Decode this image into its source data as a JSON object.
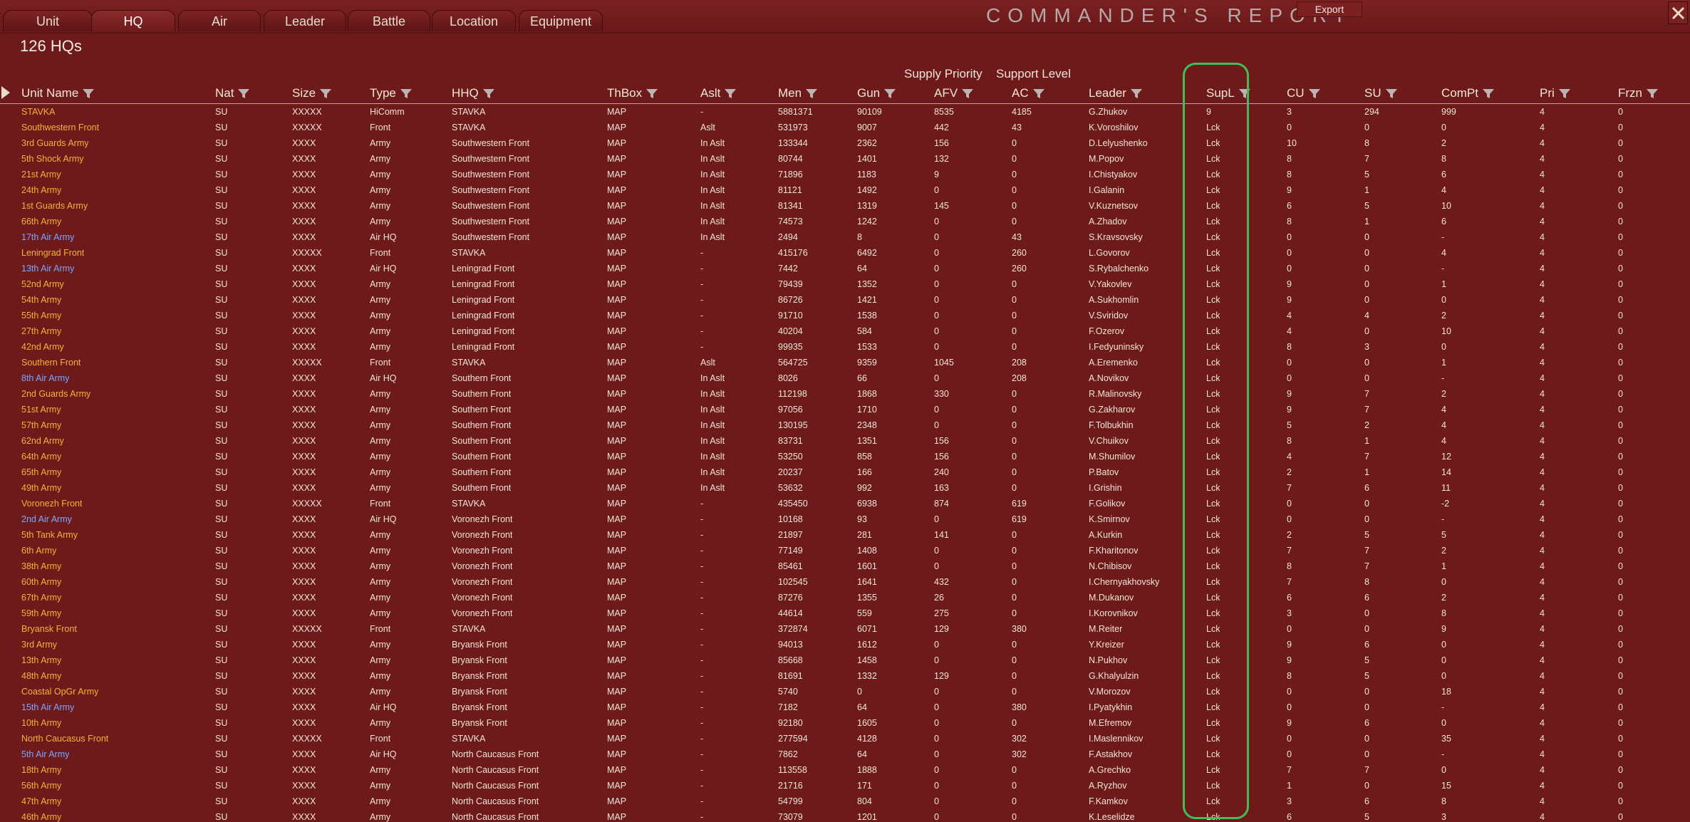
{
  "tabs": [
    "Unit",
    "HQ",
    "Air",
    "Leader",
    "Battle",
    "Location",
    "Equipment"
  ],
  "active_tab": "HQ",
  "report_title": "COMMANDER'S  REPORT",
  "export_label": "Export",
  "count_label": "126 HQs",
  "column_groups": [
    "Supply Priority",
    "Support Level"
  ],
  "columns": [
    "Unit Name",
    "Nat",
    "Size",
    "Type",
    "HHQ",
    "ThBox",
    "Aslt",
    "Men",
    "Gun",
    "AFV",
    "AC",
    "Leader",
    "SupL",
    "CU",
    "SU",
    "ComPt",
    "Pri",
    "Frzn"
  ],
  "colors": {
    "name_hq": "#f2b436",
    "name_air": "#7aa8ff",
    "highlight": "#3fbf57",
    "background": "#6e1a1b"
  },
  "rows": [
    {
      "name": "STAVKA",
      "air": false,
      "nat": "SU",
      "size": "XXXXX",
      "type": "HiComm",
      "hhq": "STAVKA",
      "thbox": "MAP",
      "aslt": "-",
      "men": "5881371",
      "gun": "90109",
      "afv": "8535",
      "ac": "4185",
      "leader": "G.Zhukov",
      "supl": "9",
      "cu": "3",
      "su": "294",
      "compt": "999",
      "pri": "4",
      "frzn": "0"
    },
    {
      "name": "Southwestern Front",
      "air": false,
      "nat": "SU",
      "size": "XXXXX",
      "type": "Front",
      "hhq": "STAVKA",
      "thbox": "MAP",
      "aslt": "Aslt",
      "men": "531973",
      "gun": "9007",
      "afv": "442",
      "ac": "43",
      "leader": "K.Voroshilov",
      "supl": "Lck",
      "cu": "0",
      "su": "0",
      "compt": "0",
      "pri": "4",
      "frzn": "0"
    },
    {
      "name": "3rd Guards Army",
      "air": false,
      "nat": "SU",
      "size": "XXXX",
      "type": "Army",
      "hhq": "Southwestern Front",
      "thbox": "MAP",
      "aslt": "In Aslt",
      "men": "133344",
      "gun": "2362",
      "afv": "156",
      "ac": "0",
      "leader": "D.Lelyushenko",
      "supl": "Lck",
      "cu": "10",
      "su": "8",
      "compt": "2",
      "pri": "4",
      "frzn": "0"
    },
    {
      "name": "5th Shock Army",
      "air": false,
      "nat": "SU",
      "size": "XXXX",
      "type": "Army",
      "hhq": "Southwestern Front",
      "thbox": "MAP",
      "aslt": "In Aslt",
      "men": "80744",
      "gun": "1401",
      "afv": "132",
      "ac": "0",
      "leader": "M.Popov",
      "supl": "Lck",
      "cu": "8",
      "su": "7",
      "compt": "8",
      "pri": "4",
      "frzn": "0"
    },
    {
      "name": "21st Army",
      "air": false,
      "nat": "SU",
      "size": "XXXX",
      "type": "Army",
      "hhq": "Southwestern Front",
      "thbox": "MAP",
      "aslt": "In Aslt",
      "men": "71896",
      "gun": "1183",
      "afv": "9",
      "ac": "0",
      "leader": "I.Chistyakov",
      "supl": "Lck",
      "cu": "8",
      "su": "5",
      "compt": "6",
      "pri": "4",
      "frzn": "0"
    },
    {
      "name": "24th Army",
      "air": false,
      "nat": "SU",
      "size": "XXXX",
      "type": "Army",
      "hhq": "Southwestern Front",
      "thbox": "MAP",
      "aslt": "In Aslt",
      "men": "81121",
      "gun": "1492",
      "afv": "0",
      "ac": "0",
      "leader": "I.Galanin",
      "supl": "Lck",
      "cu": "9",
      "su": "1",
      "compt": "4",
      "pri": "4",
      "frzn": "0"
    },
    {
      "name": "1st Guards Army",
      "air": false,
      "nat": "SU",
      "size": "XXXX",
      "type": "Army",
      "hhq": "Southwestern Front",
      "thbox": "MAP",
      "aslt": "In Aslt",
      "men": "81341",
      "gun": "1319",
      "afv": "145",
      "ac": "0",
      "leader": "V.Kuznetsov",
      "supl": "Lck",
      "cu": "6",
      "su": "5",
      "compt": "10",
      "pri": "4",
      "frzn": "0"
    },
    {
      "name": "66th Army",
      "air": false,
      "nat": "SU",
      "size": "XXXX",
      "type": "Army",
      "hhq": "Southwestern Front",
      "thbox": "MAP",
      "aslt": "In Aslt",
      "men": "74573",
      "gun": "1242",
      "afv": "0",
      "ac": "0",
      "leader": "A.Zhadov",
      "supl": "Lck",
      "cu": "8",
      "su": "1",
      "compt": "6",
      "pri": "4",
      "frzn": "0"
    },
    {
      "name": "17th Air Army",
      "air": true,
      "nat": "SU",
      "size": "XXXX",
      "type": "Air HQ",
      "hhq": "Southwestern Front",
      "thbox": "MAP",
      "aslt": "In Aslt",
      "men": "2494",
      "gun": "8",
      "afv": "0",
      "ac": "43",
      "leader": "S.Kravsovsky",
      "supl": "Lck",
      "cu": "0",
      "su": "0",
      "compt": "-",
      "pri": "4",
      "frzn": "0"
    },
    {
      "name": "Leningrad Front",
      "air": false,
      "nat": "SU",
      "size": "XXXXX",
      "type": "Front",
      "hhq": "STAVKA",
      "thbox": "MAP",
      "aslt": "-",
      "men": "415176",
      "gun": "6492",
      "afv": "0",
      "ac": "260",
      "leader": "L.Govorov",
      "supl": "Lck",
      "cu": "0",
      "su": "0",
      "compt": "4",
      "pri": "4",
      "frzn": "0"
    },
    {
      "name": "13th Air Army",
      "air": true,
      "nat": "SU",
      "size": "XXXX",
      "type": "Air HQ",
      "hhq": "Leningrad Front",
      "thbox": "MAP",
      "aslt": "-",
      "men": "7442",
      "gun": "64",
      "afv": "0",
      "ac": "260",
      "leader": "S.Rybalchenko",
      "supl": "Lck",
      "cu": "0",
      "su": "0",
      "compt": "-",
      "pri": "4",
      "frzn": "0"
    },
    {
      "name": "52nd Army",
      "air": false,
      "nat": "SU",
      "size": "XXXX",
      "type": "Army",
      "hhq": "Leningrad Front",
      "thbox": "MAP",
      "aslt": "-",
      "men": "79439",
      "gun": "1352",
      "afv": "0",
      "ac": "0",
      "leader": "V.Yakovlev",
      "supl": "Lck",
      "cu": "9",
      "su": "0",
      "compt": "1",
      "pri": "4",
      "frzn": "0"
    },
    {
      "name": "54th Army",
      "air": false,
      "nat": "SU",
      "size": "XXXX",
      "type": "Army",
      "hhq": "Leningrad Front",
      "thbox": "MAP",
      "aslt": "-",
      "men": "86726",
      "gun": "1421",
      "afv": "0",
      "ac": "0",
      "leader": "A.Sukhomlin",
      "supl": "Lck",
      "cu": "9",
      "su": "0",
      "compt": "0",
      "pri": "4",
      "frzn": "0"
    },
    {
      "name": "55th Army",
      "air": false,
      "nat": "SU",
      "size": "XXXX",
      "type": "Army",
      "hhq": "Leningrad Front",
      "thbox": "MAP",
      "aslt": "-",
      "men": "91710",
      "gun": "1538",
      "afv": "0",
      "ac": "0",
      "leader": "V.Sviridov",
      "supl": "Lck",
      "cu": "4",
      "su": "4",
      "compt": "2",
      "pri": "4",
      "frzn": "0"
    },
    {
      "name": "27th Army",
      "air": false,
      "nat": "SU",
      "size": "XXXX",
      "type": "Army",
      "hhq": "Leningrad Front",
      "thbox": "MAP",
      "aslt": "-",
      "men": "40204",
      "gun": "584",
      "afv": "0",
      "ac": "0",
      "leader": "F.Ozerov",
      "supl": "Lck",
      "cu": "4",
      "su": "0",
      "compt": "10",
      "pri": "4",
      "frzn": "0"
    },
    {
      "name": "42nd Army",
      "air": false,
      "nat": "SU",
      "size": "XXXX",
      "type": "Army",
      "hhq": "Leningrad Front",
      "thbox": "MAP",
      "aslt": "-",
      "men": "99935",
      "gun": "1533",
      "afv": "0",
      "ac": "0",
      "leader": "I.Fedyuninsky",
      "supl": "Lck",
      "cu": "8",
      "su": "3",
      "compt": "0",
      "pri": "4",
      "frzn": "0"
    },
    {
      "name": "Southern Front",
      "air": false,
      "nat": "SU",
      "size": "XXXXX",
      "type": "Front",
      "hhq": "STAVKA",
      "thbox": "MAP",
      "aslt": "Aslt",
      "men": "564725",
      "gun": "9359",
      "afv": "1045",
      "ac": "208",
      "leader": "A.Eremenko",
      "supl": "Lck",
      "cu": "0",
      "su": "0",
      "compt": "1",
      "pri": "4",
      "frzn": "0"
    },
    {
      "name": "8th Air Army",
      "air": true,
      "nat": "SU",
      "size": "XXXX",
      "type": "Air HQ",
      "hhq": "Southern Front",
      "thbox": "MAP",
      "aslt": "In Aslt",
      "men": "8026",
      "gun": "66",
      "afv": "0",
      "ac": "208",
      "leader": "A.Novikov",
      "supl": "Lck",
      "cu": "0",
      "su": "0",
      "compt": "-",
      "pri": "4",
      "frzn": "0"
    },
    {
      "name": "2nd Guards Army",
      "air": false,
      "nat": "SU",
      "size": "XXXX",
      "type": "Army",
      "hhq": "Southern Front",
      "thbox": "MAP",
      "aslt": "In Aslt",
      "men": "112198",
      "gun": "1868",
      "afv": "330",
      "ac": "0",
      "leader": "R.Malinovsky",
      "supl": "Lck",
      "cu": "9",
      "su": "7",
      "compt": "2",
      "pri": "4",
      "frzn": "0"
    },
    {
      "name": "51st Army",
      "air": false,
      "nat": "SU",
      "size": "XXXX",
      "type": "Army",
      "hhq": "Southern Front",
      "thbox": "MAP",
      "aslt": "In Aslt",
      "men": "97056",
      "gun": "1710",
      "afv": "0",
      "ac": "0",
      "leader": "G.Zakharov",
      "supl": "Lck",
      "cu": "9",
      "su": "7",
      "compt": "4",
      "pri": "4",
      "frzn": "0"
    },
    {
      "name": "57th Army",
      "air": false,
      "nat": "SU",
      "size": "XXXX",
      "type": "Army",
      "hhq": "Southern Front",
      "thbox": "MAP",
      "aslt": "In Aslt",
      "men": "130195",
      "gun": "2348",
      "afv": "0",
      "ac": "0",
      "leader": "F.Tolbukhin",
      "supl": "Lck",
      "cu": "5",
      "su": "2",
      "compt": "4",
      "pri": "4",
      "frzn": "0"
    },
    {
      "name": "62nd Army",
      "air": false,
      "nat": "SU",
      "size": "XXXX",
      "type": "Army",
      "hhq": "Southern Front",
      "thbox": "MAP",
      "aslt": "In Aslt",
      "men": "83731",
      "gun": "1351",
      "afv": "156",
      "ac": "0",
      "leader": "V.Chuikov",
      "supl": "Lck",
      "cu": "8",
      "su": "1",
      "compt": "4",
      "pri": "4",
      "frzn": "0"
    },
    {
      "name": "64th Army",
      "air": false,
      "nat": "SU",
      "size": "XXXX",
      "type": "Army",
      "hhq": "Southern Front",
      "thbox": "MAP",
      "aslt": "In Aslt",
      "men": "53250",
      "gun": "858",
      "afv": "156",
      "ac": "0",
      "leader": "M.Shumilov",
      "supl": "Lck",
      "cu": "4",
      "su": "7",
      "compt": "12",
      "pri": "4",
      "frzn": "0"
    },
    {
      "name": "65th Army",
      "air": false,
      "nat": "SU",
      "size": "XXXX",
      "type": "Army",
      "hhq": "Southern Front",
      "thbox": "MAP",
      "aslt": "In Aslt",
      "men": "20237",
      "gun": "166",
      "afv": "240",
      "ac": "0",
      "leader": "P.Batov",
      "supl": "Lck",
      "cu": "2",
      "su": "1",
      "compt": "14",
      "pri": "4",
      "frzn": "0"
    },
    {
      "name": "49th Army",
      "air": false,
      "nat": "SU",
      "size": "XXXX",
      "type": "Army",
      "hhq": "Southern Front",
      "thbox": "MAP",
      "aslt": "In Aslt",
      "men": "53632",
      "gun": "992",
      "afv": "163",
      "ac": "0",
      "leader": "I.Grishin",
      "supl": "Lck",
      "cu": "7",
      "su": "6",
      "compt": "11",
      "pri": "4",
      "frzn": "0"
    },
    {
      "name": "Voronezh Front",
      "air": false,
      "nat": "SU",
      "size": "XXXXX",
      "type": "Front",
      "hhq": "STAVKA",
      "thbox": "MAP",
      "aslt": "-",
      "men": "435450",
      "gun": "6938",
      "afv": "874",
      "ac": "619",
      "leader": "F.Golikov",
      "supl": "Lck",
      "cu": "0",
      "su": "0",
      "compt": "-2",
      "pri": "4",
      "frzn": "0"
    },
    {
      "name": "2nd Air Army",
      "air": true,
      "nat": "SU",
      "size": "XXXX",
      "type": "Air HQ",
      "hhq": "Voronezh Front",
      "thbox": "MAP",
      "aslt": "-",
      "men": "10168",
      "gun": "93",
      "afv": "0",
      "ac": "619",
      "leader": "K.Smirnov",
      "supl": "Lck",
      "cu": "0",
      "su": "0",
      "compt": "-",
      "pri": "4",
      "frzn": "0"
    },
    {
      "name": "5th Tank Army",
      "air": false,
      "nat": "SU",
      "size": "XXXX",
      "type": "Army",
      "hhq": "Voronezh Front",
      "thbox": "MAP",
      "aslt": "-",
      "men": "21897",
      "gun": "281",
      "afv": "141",
      "ac": "0",
      "leader": "A.Kurkin",
      "supl": "Lck",
      "cu": "2",
      "su": "5",
      "compt": "5",
      "pri": "4",
      "frzn": "0"
    },
    {
      "name": "6th Army",
      "air": false,
      "nat": "SU",
      "size": "XXXX",
      "type": "Army",
      "hhq": "Voronezh Front",
      "thbox": "MAP",
      "aslt": "-",
      "men": "77149",
      "gun": "1408",
      "afv": "0",
      "ac": "0",
      "leader": "F.Kharitonov",
      "supl": "Lck",
      "cu": "7",
      "su": "7",
      "compt": "2",
      "pri": "4",
      "frzn": "0"
    },
    {
      "name": "38th Army",
      "air": false,
      "nat": "SU",
      "size": "XXXX",
      "type": "Army",
      "hhq": "Voronezh Front",
      "thbox": "MAP",
      "aslt": "-",
      "men": "85461",
      "gun": "1601",
      "afv": "0",
      "ac": "0",
      "leader": "N.Chibisov",
      "supl": "Lck",
      "cu": "8",
      "su": "7",
      "compt": "1",
      "pri": "4",
      "frzn": "0"
    },
    {
      "name": "60th Army",
      "air": false,
      "nat": "SU",
      "size": "XXXX",
      "type": "Army",
      "hhq": "Voronezh Front",
      "thbox": "MAP",
      "aslt": "-",
      "men": "102545",
      "gun": "1641",
      "afv": "432",
      "ac": "0",
      "leader": "I.Chernyakhovsky",
      "supl": "Lck",
      "cu": "7",
      "su": "8",
      "compt": "0",
      "pri": "4",
      "frzn": "0"
    },
    {
      "name": "67th Army",
      "air": false,
      "nat": "SU",
      "size": "XXXX",
      "type": "Army",
      "hhq": "Voronezh Front",
      "thbox": "MAP",
      "aslt": "-",
      "men": "87276",
      "gun": "1355",
      "afv": "26",
      "ac": "0",
      "leader": "M.Dukanov",
      "supl": "Lck",
      "cu": "6",
      "su": "6",
      "compt": "2",
      "pri": "4",
      "frzn": "0"
    },
    {
      "name": "59th Army",
      "air": false,
      "nat": "SU",
      "size": "XXXX",
      "type": "Army",
      "hhq": "Voronezh Front",
      "thbox": "MAP",
      "aslt": "-",
      "men": "44614",
      "gun": "559",
      "afv": "275",
      "ac": "0",
      "leader": "I.Korovnikov",
      "supl": "Lck",
      "cu": "3",
      "su": "0",
      "compt": "8",
      "pri": "4",
      "frzn": "0"
    },
    {
      "name": "Bryansk Front",
      "air": false,
      "nat": "SU",
      "size": "XXXXX",
      "type": "Front",
      "hhq": "STAVKA",
      "thbox": "MAP",
      "aslt": "-",
      "men": "372874",
      "gun": "6071",
      "afv": "129",
      "ac": "380",
      "leader": "M.Reiter",
      "supl": "Lck",
      "cu": "0",
      "su": "0",
      "compt": "9",
      "pri": "4",
      "frzn": "0"
    },
    {
      "name": "3rd Army",
      "air": false,
      "nat": "SU",
      "size": "XXXX",
      "type": "Army",
      "hhq": "Bryansk Front",
      "thbox": "MAP",
      "aslt": "-",
      "men": "94013",
      "gun": "1612",
      "afv": "0",
      "ac": "0",
      "leader": "Y.Kreizer",
      "supl": "Lck",
      "cu": "9",
      "su": "6",
      "compt": "0",
      "pri": "4",
      "frzn": "0"
    },
    {
      "name": "13th Army",
      "air": false,
      "nat": "SU",
      "size": "XXXX",
      "type": "Army",
      "hhq": "Bryansk Front",
      "thbox": "MAP",
      "aslt": "-",
      "men": "85668",
      "gun": "1458",
      "afv": "0",
      "ac": "0",
      "leader": "N.Pukhov",
      "supl": "Lck",
      "cu": "9",
      "su": "5",
      "compt": "0",
      "pri": "4",
      "frzn": "0"
    },
    {
      "name": "48th Army",
      "air": false,
      "nat": "SU",
      "size": "XXXX",
      "type": "Army",
      "hhq": "Bryansk Front",
      "thbox": "MAP",
      "aslt": "-",
      "men": "81691",
      "gun": "1332",
      "afv": "129",
      "ac": "0",
      "leader": "G.Khalyulzin",
      "supl": "Lck",
      "cu": "8",
      "su": "5",
      "compt": "0",
      "pri": "4",
      "frzn": "0"
    },
    {
      "name": "Coastal OpGr Army",
      "air": false,
      "nat": "SU",
      "size": "XXXX",
      "type": "Army",
      "hhq": "Bryansk Front",
      "thbox": "MAP",
      "aslt": "-",
      "men": "5740",
      "gun": "0",
      "afv": "0",
      "ac": "0",
      "leader": "V.Morozov",
      "supl": "Lck",
      "cu": "0",
      "su": "0",
      "compt": "18",
      "pri": "4",
      "frzn": "0"
    },
    {
      "name": "15th Air Army",
      "air": true,
      "nat": "SU",
      "size": "XXXX",
      "type": "Air HQ",
      "hhq": "Bryansk Front",
      "thbox": "MAP",
      "aslt": "-",
      "men": "7182",
      "gun": "64",
      "afv": "0",
      "ac": "380",
      "leader": "I.Pyatykhin",
      "supl": "Lck",
      "cu": "0",
      "su": "0",
      "compt": "-",
      "pri": "4",
      "frzn": "0"
    },
    {
      "name": "10th Army",
      "air": false,
      "nat": "SU",
      "size": "XXXX",
      "type": "Army",
      "hhq": "Bryansk Front",
      "thbox": "MAP",
      "aslt": "-",
      "men": "92180",
      "gun": "1605",
      "afv": "0",
      "ac": "0",
      "leader": "M.Efremov",
      "supl": "Lck",
      "cu": "9",
      "su": "6",
      "compt": "0",
      "pri": "4",
      "frzn": "0"
    },
    {
      "name": "North Caucasus Front",
      "air": false,
      "nat": "SU",
      "size": "XXXXX",
      "type": "Front",
      "hhq": "STAVKA",
      "thbox": "MAP",
      "aslt": "-",
      "men": "277594",
      "gun": "4128",
      "afv": "0",
      "ac": "302",
      "leader": "I.Maslennikov",
      "supl": "Lck",
      "cu": "0",
      "su": "0",
      "compt": "35",
      "pri": "4",
      "frzn": "0"
    },
    {
      "name": "5th Air Army",
      "air": true,
      "nat": "SU",
      "size": "XXXX",
      "type": "Air HQ",
      "hhq": "North Caucasus Front",
      "thbox": "MAP",
      "aslt": "-",
      "men": "7862",
      "gun": "64",
      "afv": "0",
      "ac": "302",
      "leader": "F.Astakhov",
      "supl": "Lck",
      "cu": "0",
      "su": "0",
      "compt": "-",
      "pri": "4",
      "frzn": "0"
    },
    {
      "name": "18th Army",
      "air": false,
      "nat": "SU",
      "size": "XXXX",
      "type": "Army",
      "hhq": "North Caucasus Front",
      "thbox": "MAP",
      "aslt": "-",
      "men": "113558",
      "gun": "1888",
      "afv": "0",
      "ac": "0",
      "leader": "A.Grechko",
      "supl": "Lck",
      "cu": "7",
      "su": "7",
      "compt": "0",
      "pri": "4",
      "frzn": "0"
    },
    {
      "name": "56th Army",
      "air": false,
      "nat": "SU",
      "size": "XXXX",
      "type": "Army",
      "hhq": "North Caucasus Front",
      "thbox": "MAP",
      "aslt": "-",
      "men": "21716",
      "gun": "171",
      "afv": "0",
      "ac": "0",
      "leader": "A.Ryzhov",
      "supl": "Lck",
      "cu": "1",
      "su": "0",
      "compt": "15",
      "pri": "4",
      "frzn": "0"
    },
    {
      "name": "47th Army",
      "air": false,
      "nat": "SU",
      "size": "XXXX",
      "type": "Army",
      "hhq": "North Caucasus Front",
      "thbox": "MAP",
      "aslt": "-",
      "men": "54799",
      "gun": "804",
      "afv": "0",
      "ac": "0",
      "leader": "F.Kamkov",
      "supl": "Lck",
      "cu": "3",
      "su": "6",
      "compt": "8",
      "pri": "4",
      "frzn": "0"
    },
    {
      "name": "46th Army",
      "air": false,
      "nat": "SU",
      "size": "XXXX",
      "type": "Army",
      "hhq": "North Caucasus Front",
      "thbox": "MAP",
      "aslt": "-",
      "men": "73079",
      "gun": "1201",
      "afv": "0",
      "ac": "0",
      "leader": "K.Leselidze",
      "supl": "Lck",
      "cu": "6",
      "su": "5",
      "compt": "3",
      "pri": "4",
      "frzn": "0"
    }
  ]
}
